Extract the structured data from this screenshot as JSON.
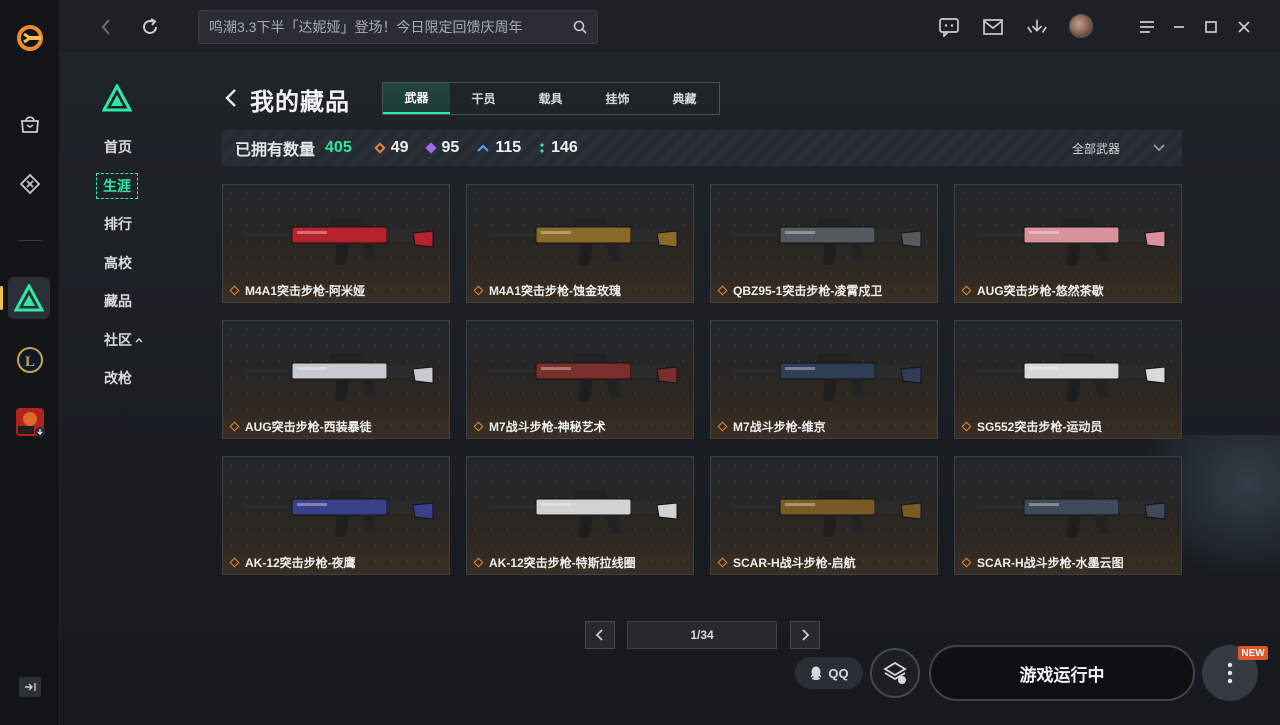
{
  "search": {
    "placeholder": "鸣潮3.3下半「达妮娅」登场！今日限定回馈庆周年"
  },
  "sidebar_nav": [
    "首页",
    "生涯",
    "排行",
    "高校",
    "藏品",
    "社区",
    "改枪"
  ],
  "sidebar_active": "生涯",
  "page_title": "我的藏品",
  "tabs": [
    "武器",
    "干员",
    "载具",
    "挂饰",
    "典藏"
  ],
  "active_tab": "武器",
  "stats": {
    "owned_label": "已拥有数量",
    "owned_total": "405",
    "rarities": [
      {
        "count": "49",
        "color": "#e58a3a"
      },
      {
        "count": "95",
        "color": "#9b6cf0"
      },
      {
        "count": "115",
        "color": "#4aa3ef"
      },
      {
        "count": "146",
        "color": "#2fe8a6"
      }
    ],
    "filter_label": "全部武器"
  },
  "items": [
    {
      "name": "M4A1突击步枪-阿米娅",
      "color": "#b8222c"
    },
    {
      "name": "M4A1突击步枪-蚀金玫瑰",
      "color": "#8a6a2a"
    },
    {
      "name": "QBZ95-1突击步枪-凌霄戍卫",
      "color": "#555a60"
    },
    {
      "name": "AUG突击步枪-悠然茶歇",
      "color": "#d8939a"
    },
    {
      "name": "AUG突击步枪-西装暴徒",
      "color": "#c7cad3"
    },
    {
      "name": "M7战斗步枪-神秘艺术",
      "color": "#7a2f2c"
    },
    {
      "name": "M7战斗步枪-维京",
      "color": "#2e3e55"
    },
    {
      "name": "SG552突击步枪-运动员",
      "color": "#d9d9d9"
    },
    {
      "name": "AK-12突击步枪-夜鹰",
      "color": "#3a3f8a"
    },
    {
      "name": "AK-12突击步枪-特斯拉线圈",
      "color": "#d0d2d4"
    },
    {
      "name": "SCAR-H战斗步枪-启航",
      "color": "#7a5a24"
    },
    {
      "name": "SCAR-H战斗步枪-水墨云图",
      "color": "#3e4a5a"
    }
  ],
  "pagination": {
    "label": "1/34"
  },
  "bottom": {
    "qq_label": "QQ",
    "launch_label": "游戏运行中",
    "new_badge": "NEW"
  }
}
